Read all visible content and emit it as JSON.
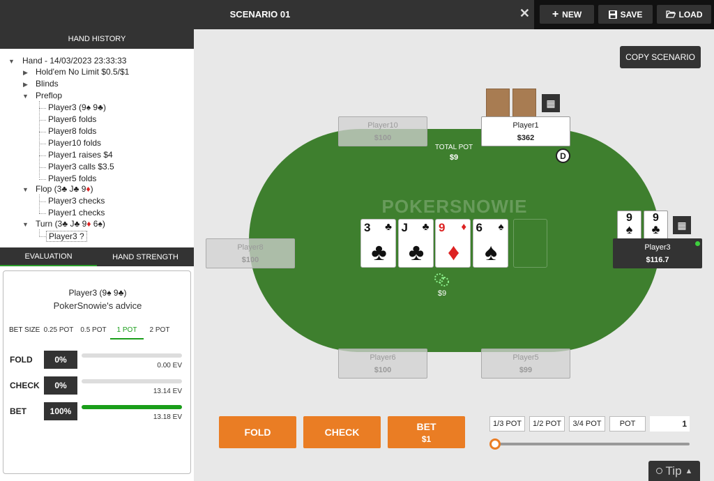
{
  "header": {
    "title": "SCENARIO 01",
    "close": "✕",
    "new_label": "NEW",
    "save_label": "SAVE",
    "load_label": "LOAD"
  },
  "history": {
    "title": "HAND HISTORY",
    "hand": "Hand  - 14/03/2023 23:33:33",
    "game": "Hold'em No Limit $0.5/$1",
    "blinds": "Blinds",
    "preflop": "Preflop",
    "preflop_actions": [
      "Player3 (9♠ 9♣)",
      "Player6 folds",
      "Player8 folds",
      "Player10 folds",
      "Player1 raises $4",
      "Player3 calls $3.5",
      "Player5 folds"
    ],
    "flop": {
      "pre": "Flop (3♣ J♣ 9",
      "red": "♦",
      "post": ")"
    },
    "flop_actions": [
      "Player3 checks",
      "Player1 checks"
    ],
    "turn": {
      "pre": "Turn (3♣ J♣ 9",
      "red": "♦",
      "post": " 6♠)"
    },
    "turn_actions": [
      "Player3 ?"
    ]
  },
  "eval": {
    "tabs": [
      "EVALUATION",
      "HAND STRENGTH"
    ],
    "player": "Player3 (9♠ 9♣)",
    "advice": "PokerSnowie's advice",
    "betsize_label": "BET SIZE",
    "betsizes": [
      "0.25 POT",
      "0.5 POT",
      "1 POT",
      "2 POT"
    ],
    "selected_betsize": "1 POT",
    "actions": [
      {
        "label": "FOLD",
        "pct": "0%",
        "fill": 0,
        "ev": "0.00 EV"
      },
      {
        "label": "CHECK",
        "pct": "0%",
        "fill": 0,
        "ev": "13.14 EV"
      },
      {
        "label": "BET",
        "pct": "100%",
        "fill": 100,
        "ev": "13.18 EV"
      }
    ]
  },
  "table": {
    "copy_label": "COPY SCENARIO",
    "total_pot_label": "TOTAL POT",
    "total_pot": "$9",
    "pot_chips": "$9",
    "watermark": "POKERSNOWIE",
    "dealer": "D",
    "board": [
      {
        "rank": "3",
        "suit": "♣"
      },
      {
        "rank": "J",
        "suit": "♣"
      },
      {
        "rank": "9",
        "suit": "♦"
      },
      {
        "rank": "6",
        "suit": "♠"
      }
    ],
    "seats": {
      "player10": {
        "name": "Player10",
        "stack": "$100"
      },
      "player1": {
        "name": "Player1",
        "stack": "$362"
      },
      "player8": {
        "name": "Player8",
        "stack": "$100"
      },
      "player3": {
        "name": "Player3",
        "stack": "$116.7"
      },
      "player6": {
        "name": "Player6",
        "stack": "$100"
      },
      "player5": {
        "name": "Player5",
        "stack": "$99"
      }
    },
    "hero_cards": [
      {
        "rank": "9",
        "suit": "♠"
      },
      {
        "rank": "9",
        "suit": "♣"
      }
    ]
  },
  "actions": {
    "fold": "FOLD",
    "check": "CHECK",
    "bet": "BET",
    "bet_amount": "$1"
  },
  "presets": [
    "1/3 POT",
    "1/2 POT",
    "3/4 POT",
    "POT"
  ],
  "bet_input": "1",
  "slider_fraction": 0,
  "tip": "Tip"
}
